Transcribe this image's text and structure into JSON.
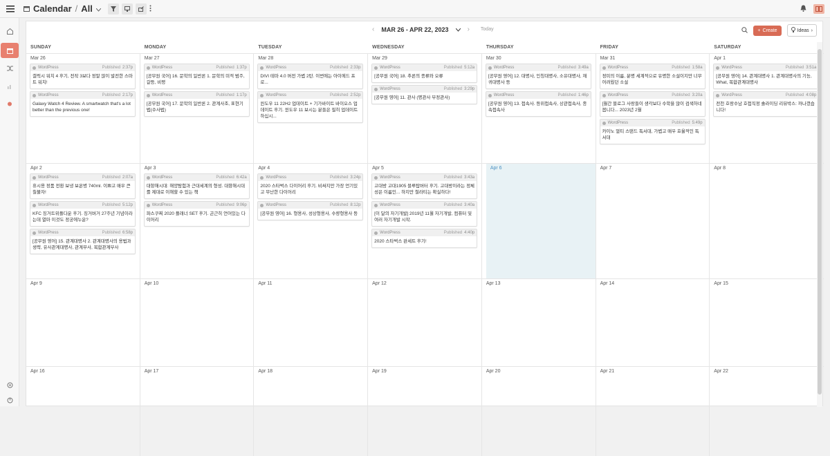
{
  "app": {
    "title": "Calendar",
    "separator": "/",
    "view": "All"
  },
  "nav": {
    "range": "MAR 26 - APR 22, 2023",
    "today": "Today"
  },
  "actions": {
    "create": "Create",
    "ideas": "Ideas"
  },
  "weekdays": [
    "SUNDAY",
    "MONDAY",
    "TUESDAY",
    "WEDNESDAY",
    "THURSDAY",
    "FRIDAY",
    "SATURDAY"
  ],
  "weeks": [
    {
      "days": [
        {
          "label": "Mar 26",
          "cards": [
            {
              "source": "WordPress",
              "status": "Published",
              "time": "2:37p",
              "text": "갤럭시 워치 4 후기, 전작 3보다 정말 많이 발전한 스마트 워치!"
            },
            {
              "source": "WordPress",
              "status": "Published",
              "time": "2:17p",
              "text": "Galaxy Watch 4 Review. A smartwatch that's a lot better than the previous one!"
            }
          ]
        },
        {
          "label": "Mar 27",
          "cards": [
            {
              "source": "WordPress",
              "status": "Published",
              "time": "1:37p",
              "text": "[공무원 국어] 16. 문학의 일반론 1. 문학의 미적 범주, 갈등, 비평"
            },
            {
              "source": "WordPress",
              "status": "Published",
              "time": "1:17p",
              "text": "[공무원 국어] 17. 문학의 일반론 2. 관계사조, 표현기법(수사법)"
            }
          ]
        },
        {
          "label": "Mar 28",
          "cards": [
            {
              "source": "WordPress",
              "status": "Published",
              "time": "2:33p",
              "text": "DIVI 테마 4.0 버전 가볍 2탄. 이번에는 아이에드 프로..."
            },
            {
              "source": "WordPress",
              "status": "Published",
              "time": "2:52p",
              "text": "윈도우 11 22H2 업데이트 + 기가바이트 바이오스 업데이트 후기. 윈도우 11 보시는 분들은 필히 업데이트하십시..."
            }
          ]
        },
        {
          "label": "Mar 29",
          "cards": [
            {
              "source": "WordPress",
              "status": "Published",
              "time": "5:12a",
              "text": "[공무원 국어] 18. 추론의 종류와 오류"
            },
            {
              "source": "WordPress",
              "status": "Published",
              "time": "3:29p",
              "text": "[공무원 영어] 11. 관사 (명관사 부정관사)"
            }
          ]
        },
        {
          "label": "Mar 30",
          "cards": [
            {
              "source": "WordPress",
              "status": "Published",
              "time": "3:49a",
              "text": "[공무원 영어] 12. 대명사, 인칭대명사, 소유대명사, 재귀대명사 등"
            },
            {
              "source": "WordPress",
              "status": "Published",
              "time": "1:46p",
              "text": "[공무원 영어] 13. 접속사. 등위접속사, 상관접속사, 종속접속사"
            }
          ]
        },
        {
          "label": "Mar 31",
          "cards": [
            {
              "source": "WordPress",
              "status": "Published",
              "time": "1:58a",
              "text": "정미의 이름, 분명 세계적으로 유명한 소설이지만 너무 어려웠던 소설"
            },
            {
              "source": "WordPress",
              "status": "Published",
              "time": "3:20a",
              "text": "[월간 블로그 사랑들이 생각보다 수학을 많이 검색하네봅니다... 2023년 2월"
            },
            {
              "source": "WordPress",
              "status": "Published",
              "time": "5:49p",
              "text": "카이노 멀티 스탠드 독서대, 가볍고 매우 효율적인 독서대"
            }
          ]
        },
        {
          "label": "Apr 1",
          "cards": [
            {
              "source": "WordPress",
              "status": "Published",
              "time": "3:51a",
              "text": "[공무원 영어] 14. 관계대명사 1. 관계대명사의 기능, What, 복합관계대명사"
            },
            {
              "source": "WordPress",
              "status": "Published",
              "time": "4:08p",
              "text": "전천 호랑수남 호접직정 솔라이딩 리뷰박스: 까나갰습니다!"
            }
          ]
        }
      ]
    },
    {
      "days": [
        {
          "label": "Apr 2",
          "cards": [
            {
              "source": "WordPress",
              "status": "Published",
              "time": "2:07a",
              "text": "휴시용 정품 전환 보냉 보온병 740ml. 이쁘고 매우 큰 칠불자!"
            },
            {
              "source": "WordPress",
              "status": "Published",
              "time": "5:12p",
              "text": "KFC 징거트위플다운 후기. 징거버거 27주년 기념이라는데 열마 이것도 정궁에누운?"
            },
            {
              "source": "WordPress",
              "status": "Published",
              "time": "6:58p",
              "text": "[공무원 영어] 15. 관계대명사 2. 관계대명사의 용법과 생략, 유사관계대명사, 관계부사, 복합관계부사"
            }
          ]
        },
        {
          "label": "Apr 3",
          "cards": [
            {
              "source": "WordPress",
              "status": "Published",
              "time": "6:42a",
              "text": "대항해시대: 해양탐험과 근대세계의 형성. 대항해시대를 제대로 이해할 수 있는 책"
            },
            {
              "source": "WordPress",
              "status": "Published",
              "time": "9:06p",
              "text": "파스쿠찌 2020 플래너 SET 후기. 곤근히 언어있는 다이어리"
            }
          ]
        },
        {
          "label": "Apr 4",
          "cards": [
            {
              "source": "WordPress",
              "status": "Published",
              "time": "3:24p",
              "text": "2020 스타벅스 다이어리 후기. 비싸지만 가장 언기있고 무난한 다이어리"
            },
            {
              "source": "WordPress",
              "status": "Published",
              "time": "8:12p",
              "text": "[공무원 영어] 16. 형용사, 성상형용사, 수량형용사 등"
            }
          ]
        },
        {
          "label": "Apr 5",
          "cards": [
            {
              "source": "WordPress",
              "status": "Published",
              "time": "3:43a",
              "text": "고대방 고대1905 블루탑버터 후기. 고대방이라는 정체성은 이름인... 하지만 철라티는 확실하다!"
            },
            {
              "source": "WordPress",
              "status": "Published",
              "time": "3:40a",
              "text": "[이 달의 자기개발] 2019년 11월 자기개발, 컴퓨터 및 여러 자기개발 시작."
            },
            {
              "source": "WordPress",
              "status": "Published",
              "time": "4:40p",
              "text": "2020 스타벅스 완세트 후기!"
            }
          ]
        },
        {
          "label": "Apr 6",
          "today": true,
          "cards": []
        },
        {
          "label": "Apr 7",
          "cards": []
        },
        {
          "label": "Apr 8",
          "cards": []
        }
      ]
    },
    {
      "days": [
        {
          "label": "Apr 9",
          "cards": []
        },
        {
          "label": "Apr 10",
          "cards": []
        },
        {
          "label": "Apr 11",
          "cards": []
        },
        {
          "label": "Apr 12",
          "cards": []
        },
        {
          "label": "Apr 13",
          "cards": []
        },
        {
          "label": "Apr 14",
          "cards": []
        },
        {
          "label": "Apr 15",
          "cards": []
        }
      ]
    },
    {
      "days": [
        {
          "label": "Apr 16",
          "cards": []
        },
        {
          "label": "Apr 17",
          "cards": []
        },
        {
          "label": "Apr 18",
          "cards": []
        },
        {
          "label": "Apr 19",
          "cards": []
        },
        {
          "label": "Apr 20",
          "cards": []
        },
        {
          "label": "Apr 21",
          "cards": []
        },
        {
          "label": "Apr 22",
          "cards": []
        }
      ]
    }
  ],
  "colors": {
    "accent": "#d86b55",
    "today_bg": "#e8f2f5",
    "card_header": "#f0f0f0"
  },
  "icons": [
    "menu-icon",
    "calendar-icon",
    "chevron-down-icon",
    "filter-icon",
    "monitor-icon",
    "share-icon",
    "more-icon",
    "bell-icon",
    "book-icon",
    "home-icon",
    "shuffle-icon",
    "chart-icon",
    "pin-icon",
    "settings-icon",
    "sign-out-icon",
    "search-icon",
    "plus-icon",
    "lightbulb-icon",
    "chevron-left-icon",
    "chevron-right-icon",
    "wordpress-icon"
  ]
}
